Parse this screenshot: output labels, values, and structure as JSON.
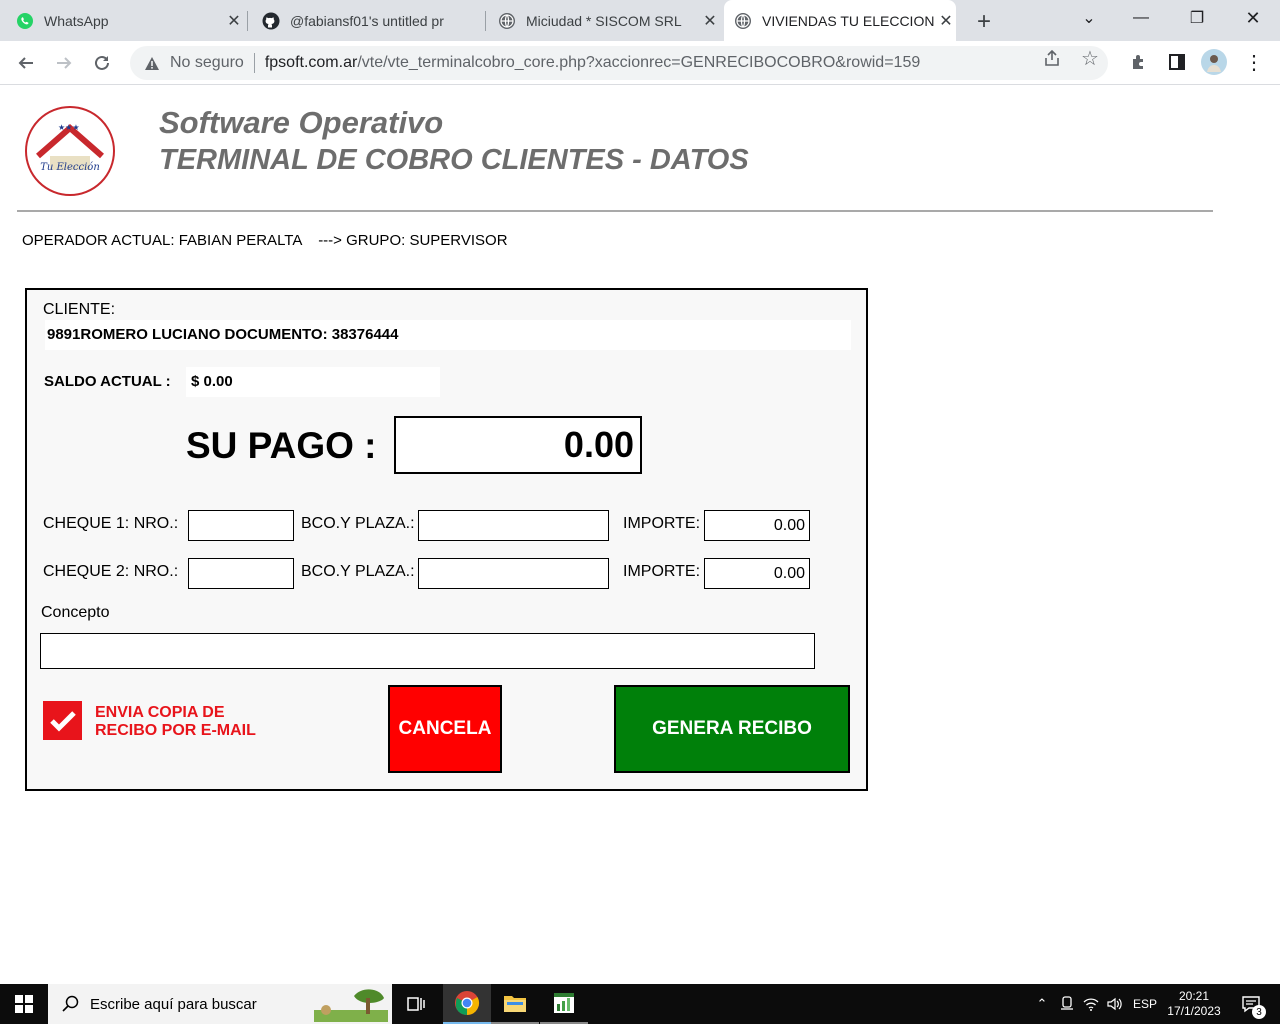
{
  "browser": {
    "tabs": [
      {
        "title": "WhatsApp",
        "icon": "whatsapp-icon"
      },
      {
        "title": "@fabiansf01's untitled pr",
        "icon": "github-icon"
      },
      {
        "title": "Miciudad * SISCOM SRL",
        "icon": "globe-icon"
      },
      {
        "title": "VIVIENDAS TU ELECCION",
        "icon": "globe-icon",
        "active": true
      }
    ],
    "security_label": "No seguro",
    "url_host": "fpsoft.com.ar",
    "url_path": "/vte/vte_terminalcobro_core.php?xaccionrec=GENRECIBOCOBRO&rowid=159"
  },
  "header": {
    "title": "Software Operativo",
    "subtitle": "TERMINAL DE COBRO CLIENTES - DATOS",
    "logo_text": "Tu Elección"
  },
  "operator": {
    "text": "OPERADOR ACTUAL: FABIAN PERALTA    ---> GRUPO: SUPERVISOR"
  },
  "form": {
    "cliente_label": "CLIENTE:",
    "cliente_value": "9891ROMERO LUCIANO DOCUMENTO: 38376444",
    "saldo_label": "SALDO ACTUAL :",
    "saldo_value": "$ 0.00",
    "pago_label": "SU PAGO :",
    "pago_value": "0.00",
    "cheque1_label": "CHEQUE 1: NRO.:",
    "cheque2_label": "CHEQUE 2: NRO.:",
    "bco_label": "BCO.Y PLAZA.:",
    "importe_label": "IMPORTE:",
    "cheque1_nro": "",
    "cheque1_bco": "",
    "cheque1_importe": "0.00",
    "cheque2_nro": "",
    "cheque2_bco": "",
    "cheque2_importe": "0.00",
    "concepto_label": "Concepto",
    "concepto_value": "",
    "email_copy_label_line1": "ENVIA COPIA DE",
    "email_copy_label_line2": "RECIBO POR E-MAIL",
    "email_copy_checked": true,
    "cancel_label": "CANCELA",
    "generate_label": "GENERA RECIBO"
  },
  "colors": {
    "cancel": "#ff0000",
    "generate": "#00800a",
    "checkbox": "#e8141b",
    "title_gray": "#6d6d6d"
  },
  "taskbar": {
    "search_placeholder": "Escribe aquí para buscar",
    "language": "ESP",
    "time": "20:21",
    "date": "17/1/2023",
    "notifications": "3"
  }
}
